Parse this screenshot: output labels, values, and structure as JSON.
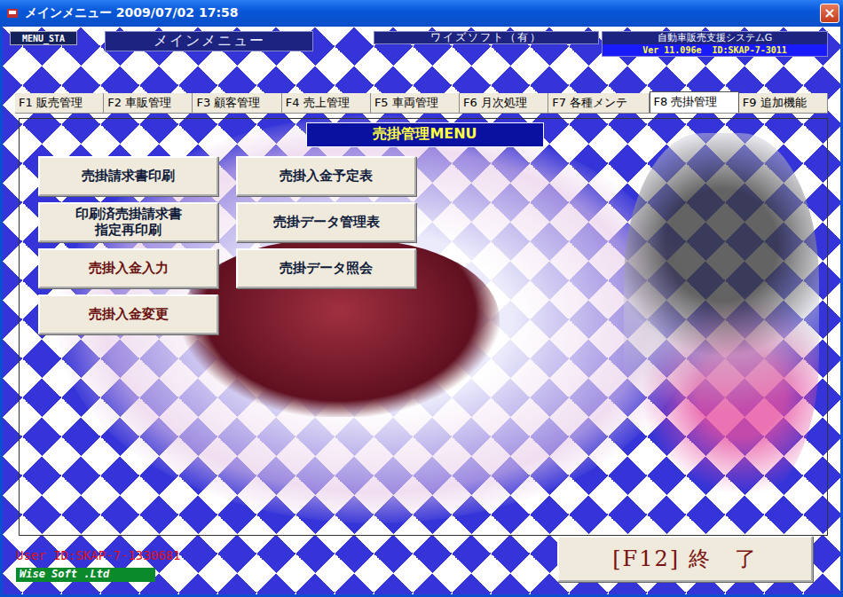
{
  "window": {
    "title": "メインメニュー 2009/07/02 17:58",
    "close": "×"
  },
  "header": {
    "code": "MENU_STA",
    "screen": "メインメニュー",
    "company": "ワイズソフト（有）",
    "system": "自動車販売支援システムG",
    "version": "Ver 11.096e  ID:SKAP-7-3011"
  },
  "tabs": [
    {
      "label": "F1 販売管理",
      "selected": false
    },
    {
      "label": "F2 車販管理",
      "selected": false
    },
    {
      "label": "F3 顧客管理",
      "selected": false
    },
    {
      "label": "F4 売上管理",
      "selected": false
    },
    {
      "label": "F5 車両管理",
      "selected": false
    },
    {
      "label": "F6 月次処理",
      "selected": false
    },
    {
      "label": "F7 各種メンテ",
      "selected": false
    },
    {
      "label": "F8 売掛管理",
      "selected": true
    },
    {
      "label": "F9 追加機能",
      "selected": false
    }
  ],
  "panel": {
    "title": "売掛管理MENU",
    "columns": [
      [
        {
          "label": "売掛請求書印刷",
          "color": "#101a3a"
        },
        {
          "label": "印刷済売掛請求書\n指定再印刷",
          "color": "#101a3a"
        },
        {
          "label": "売掛入金入力",
          "color": "#6a1010"
        },
        {
          "label": "売掛入金変更",
          "color": "#6a1010"
        }
      ],
      [
        {
          "label": "売掛入金予定表",
          "color": "#101a3a"
        },
        {
          "label": "売掛データ管理表",
          "color": "#101a3a"
        },
        {
          "label": "売掛データ照会",
          "color": "#101a3a"
        }
      ]
    ]
  },
  "footer": {
    "user": "User ID:SKAP-7-1330681",
    "brand": "Wise Soft .Ltd",
    "exit": "[F12] 終　了"
  }
}
